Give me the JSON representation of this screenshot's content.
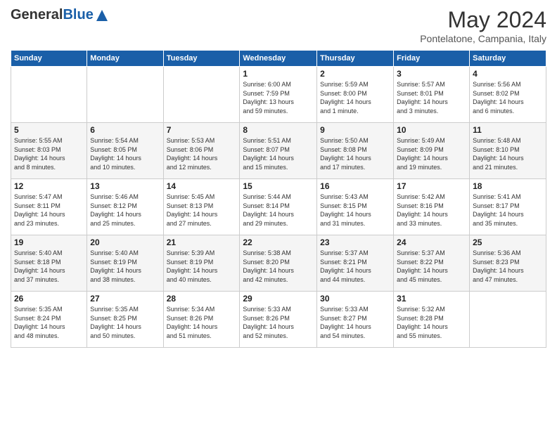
{
  "logo": {
    "general": "General",
    "blue": "Blue"
  },
  "header": {
    "month": "May 2024",
    "location": "Pontelatone, Campania, Italy"
  },
  "days_of_week": [
    "Sunday",
    "Monday",
    "Tuesday",
    "Wednesday",
    "Thursday",
    "Friday",
    "Saturday"
  ],
  "weeks": [
    [
      {
        "day": "",
        "info": ""
      },
      {
        "day": "",
        "info": ""
      },
      {
        "day": "",
        "info": ""
      },
      {
        "day": "1",
        "info": "Sunrise: 6:00 AM\nSunset: 7:59 PM\nDaylight: 13 hours\nand 59 minutes."
      },
      {
        "day": "2",
        "info": "Sunrise: 5:59 AM\nSunset: 8:00 PM\nDaylight: 14 hours\nand 1 minute."
      },
      {
        "day": "3",
        "info": "Sunrise: 5:57 AM\nSunset: 8:01 PM\nDaylight: 14 hours\nand 3 minutes."
      },
      {
        "day": "4",
        "info": "Sunrise: 5:56 AM\nSunset: 8:02 PM\nDaylight: 14 hours\nand 6 minutes."
      }
    ],
    [
      {
        "day": "5",
        "info": "Sunrise: 5:55 AM\nSunset: 8:03 PM\nDaylight: 14 hours\nand 8 minutes."
      },
      {
        "day": "6",
        "info": "Sunrise: 5:54 AM\nSunset: 8:05 PM\nDaylight: 14 hours\nand 10 minutes."
      },
      {
        "day": "7",
        "info": "Sunrise: 5:53 AM\nSunset: 8:06 PM\nDaylight: 14 hours\nand 12 minutes."
      },
      {
        "day": "8",
        "info": "Sunrise: 5:51 AM\nSunset: 8:07 PM\nDaylight: 14 hours\nand 15 minutes."
      },
      {
        "day": "9",
        "info": "Sunrise: 5:50 AM\nSunset: 8:08 PM\nDaylight: 14 hours\nand 17 minutes."
      },
      {
        "day": "10",
        "info": "Sunrise: 5:49 AM\nSunset: 8:09 PM\nDaylight: 14 hours\nand 19 minutes."
      },
      {
        "day": "11",
        "info": "Sunrise: 5:48 AM\nSunset: 8:10 PM\nDaylight: 14 hours\nand 21 minutes."
      }
    ],
    [
      {
        "day": "12",
        "info": "Sunrise: 5:47 AM\nSunset: 8:11 PM\nDaylight: 14 hours\nand 23 minutes."
      },
      {
        "day": "13",
        "info": "Sunrise: 5:46 AM\nSunset: 8:12 PM\nDaylight: 14 hours\nand 25 minutes."
      },
      {
        "day": "14",
        "info": "Sunrise: 5:45 AM\nSunset: 8:13 PM\nDaylight: 14 hours\nand 27 minutes."
      },
      {
        "day": "15",
        "info": "Sunrise: 5:44 AM\nSunset: 8:14 PM\nDaylight: 14 hours\nand 29 minutes."
      },
      {
        "day": "16",
        "info": "Sunrise: 5:43 AM\nSunset: 8:15 PM\nDaylight: 14 hours\nand 31 minutes."
      },
      {
        "day": "17",
        "info": "Sunrise: 5:42 AM\nSunset: 8:16 PM\nDaylight: 14 hours\nand 33 minutes."
      },
      {
        "day": "18",
        "info": "Sunrise: 5:41 AM\nSunset: 8:17 PM\nDaylight: 14 hours\nand 35 minutes."
      }
    ],
    [
      {
        "day": "19",
        "info": "Sunrise: 5:40 AM\nSunset: 8:18 PM\nDaylight: 14 hours\nand 37 minutes."
      },
      {
        "day": "20",
        "info": "Sunrise: 5:40 AM\nSunset: 8:19 PM\nDaylight: 14 hours\nand 38 minutes."
      },
      {
        "day": "21",
        "info": "Sunrise: 5:39 AM\nSunset: 8:19 PM\nDaylight: 14 hours\nand 40 minutes."
      },
      {
        "day": "22",
        "info": "Sunrise: 5:38 AM\nSunset: 8:20 PM\nDaylight: 14 hours\nand 42 minutes."
      },
      {
        "day": "23",
        "info": "Sunrise: 5:37 AM\nSunset: 8:21 PM\nDaylight: 14 hours\nand 44 minutes."
      },
      {
        "day": "24",
        "info": "Sunrise: 5:37 AM\nSunset: 8:22 PM\nDaylight: 14 hours\nand 45 minutes."
      },
      {
        "day": "25",
        "info": "Sunrise: 5:36 AM\nSunset: 8:23 PM\nDaylight: 14 hours\nand 47 minutes."
      }
    ],
    [
      {
        "day": "26",
        "info": "Sunrise: 5:35 AM\nSunset: 8:24 PM\nDaylight: 14 hours\nand 48 minutes."
      },
      {
        "day": "27",
        "info": "Sunrise: 5:35 AM\nSunset: 8:25 PM\nDaylight: 14 hours\nand 50 minutes."
      },
      {
        "day": "28",
        "info": "Sunrise: 5:34 AM\nSunset: 8:26 PM\nDaylight: 14 hours\nand 51 minutes."
      },
      {
        "day": "29",
        "info": "Sunrise: 5:33 AM\nSunset: 8:26 PM\nDaylight: 14 hours\nand 52 minutes."
      },
      {
        "day": "30",
        "info": "Sunrise: 5:33 AM\nSunset: 8:27 PM\nDaylight: 14 hours\nand 54 minutes."
      },
      {
        "day": "31",
        "info": "Sunrise: 5:32 AM\nSunset: 8:28 PM\nDaylight: 14 hours\nand 55 minutes."
      },
      {
        "day": "",
        "info": ""
      }
    ]
  ]
}
